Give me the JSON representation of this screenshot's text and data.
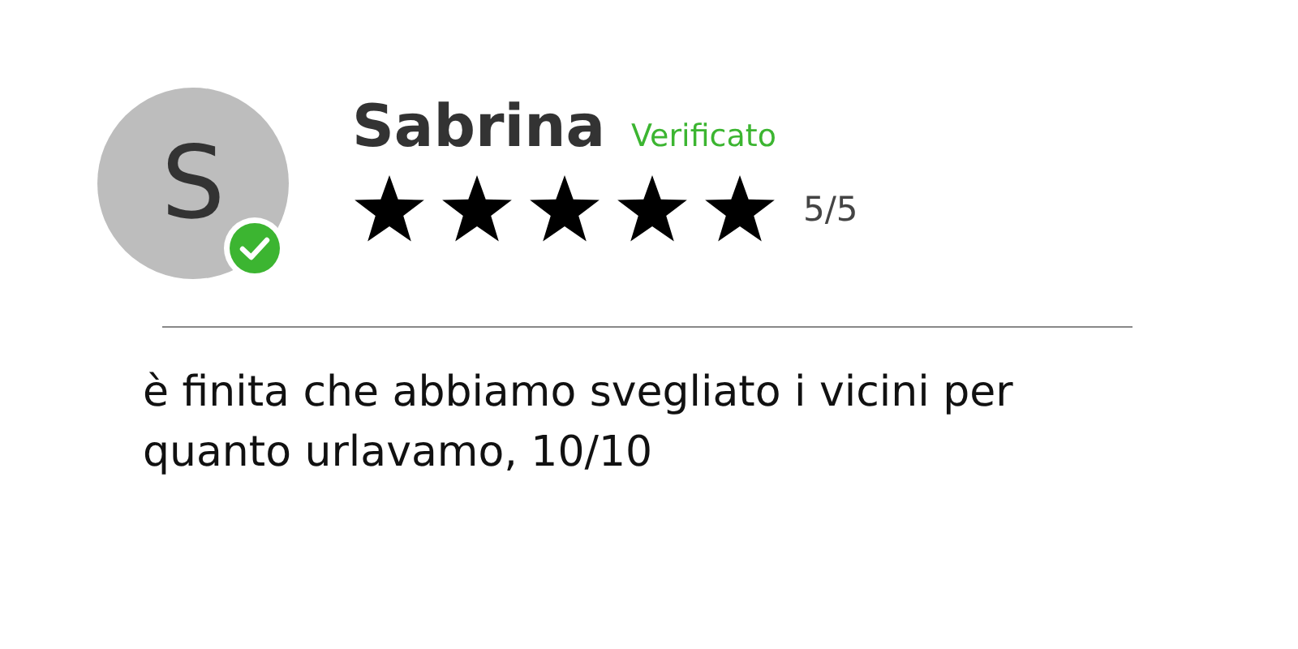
{
  "review": {
    "avatar_initial": "S",
    "verified": true,
    "name": "Sabrina",
    "verified_label": "Verificato",
    "stars": 5,
    "rating": "5/5",
    "text": "è finita che abbiamo svegliato i vicini per quanto urlavamo, 10/10"
  }
}
